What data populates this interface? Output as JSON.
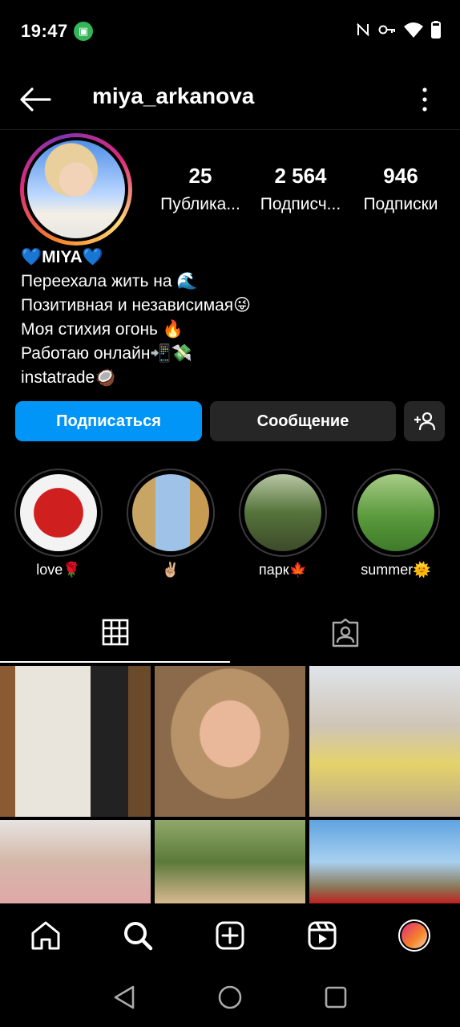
{
  "status_bar": {
    "time": "19:47"
  },
  "header": {
    "username": "miya_arkanova"
  },
  "stats": [
    {
      "value": "25",
      "label": "Публика..."
    },
    {
      "value": "2 564",
      "label": "Подписч..."
    },
    {
      "value": "946",
      "label": "Подписки"
    }
  ],
  "bio": {
    "name": "💙MIYA💙",
    "lines": [
      "Переехала жить на 🌊",
      "Позитивная и независимая😜",
      "Моя стихия огонь 🔥",
      "Работаю онлайн📲💸",
      "instatrade🥥"
    ]
  },
  "actions": {
    "follow": "Подписаться",
    "message": "Сообщение"
  },
  "highlights": [
    {
      "label": "love🌹",
      "color": "#c81a1a"
    },
    {
      "label": "✌🏼",
      "color": "#8fb8e6"
    },
    {
      "label": "парк🍁",
      "color": "#4e6b3a"
    },
    {
      "label": "summer🌞",
      "color": "#4f8a3a"
    }
  ],
  "posts_grid_colors": [
    "#3a3330",
    "#b08a66",
    "#d9c9b5",
    "#d9c7c0",
    "#7d8f5a",
    "#6aa6d8"
  ],
  "colors": {
    "accent": "#0095f6",
    "button_dark": "#262626",
    "background": "#000000"
  }
}
